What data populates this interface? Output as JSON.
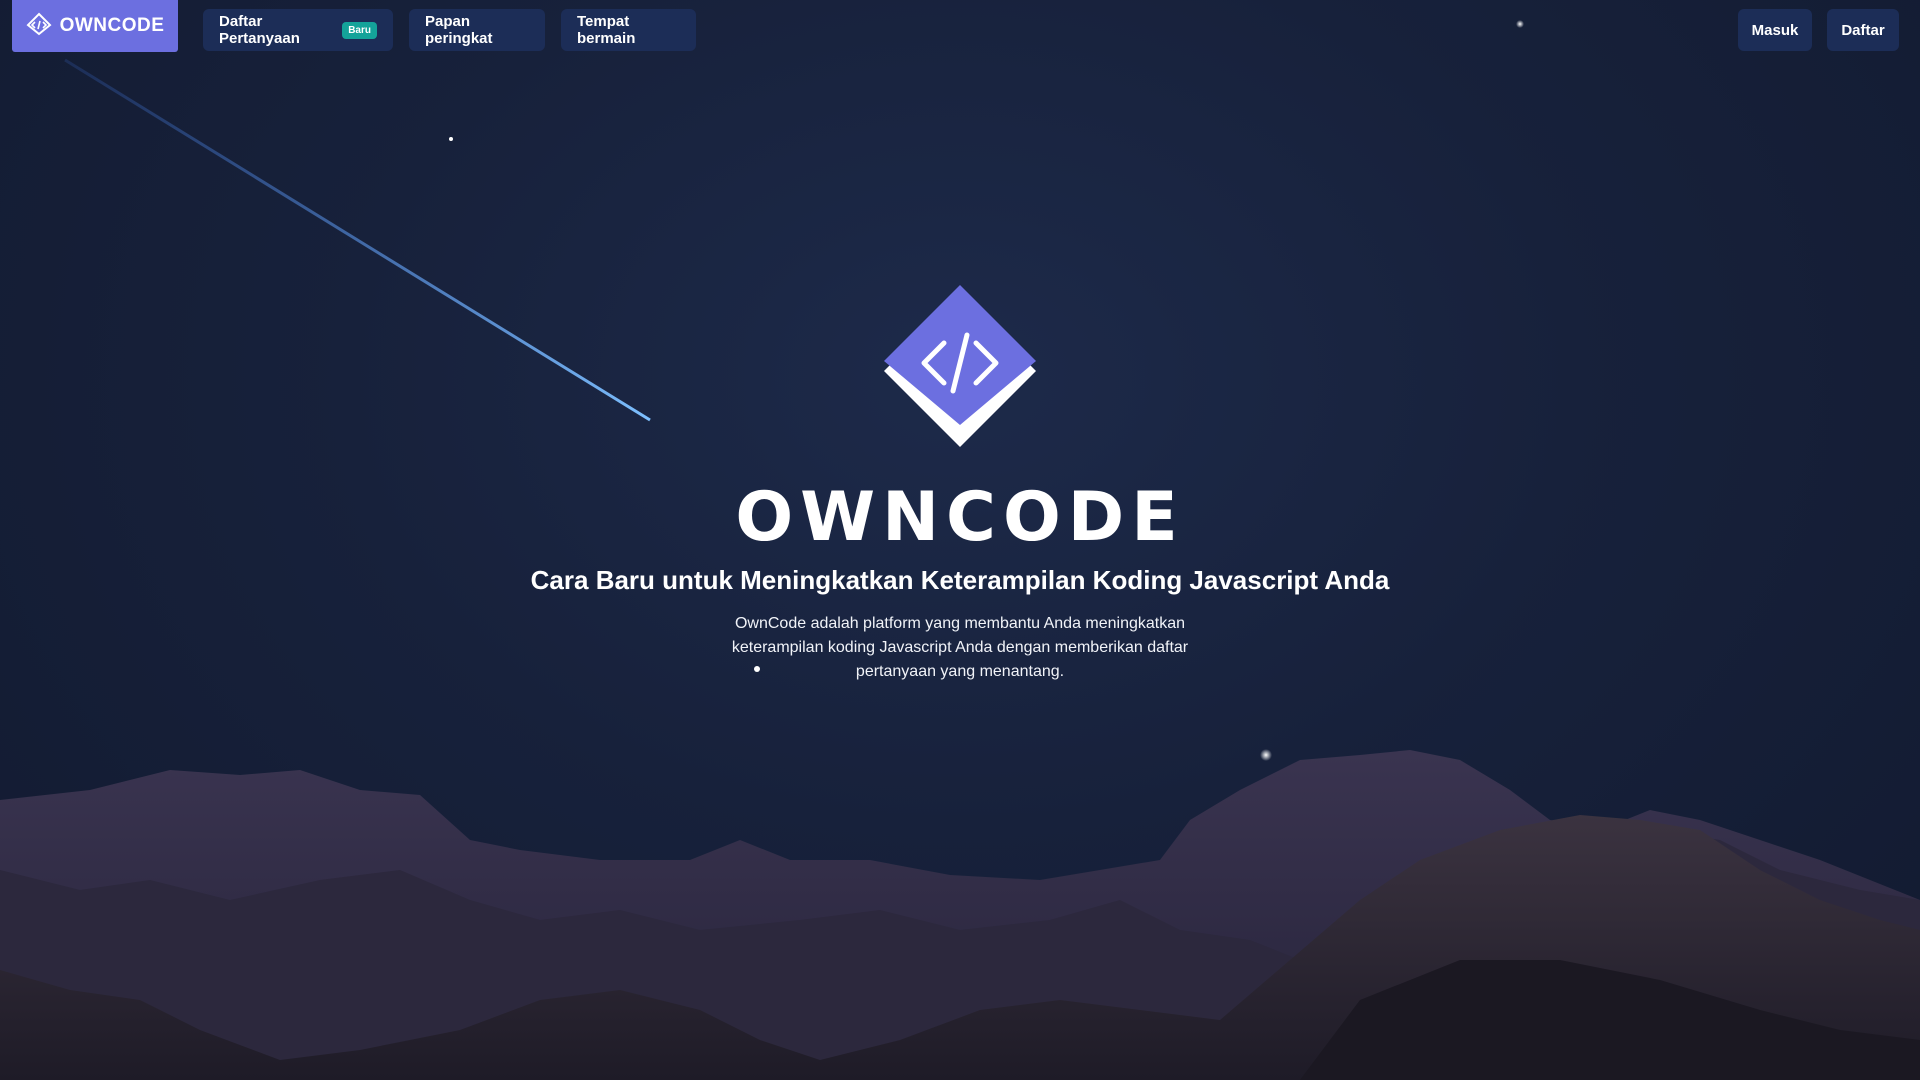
{
  "nav": {
    "logo_text": "OWNCODE",
    "items": [
      {
        "label": "Daftar Pertanyaan",
        "badge": "Baru"
      },
      {
        "label": "Papan peringkat"
      },
      {
        "label": "Tempat bermain"
      }
    ],
    "login_label": "Masuk",
    "register_label": "Daftar"
  },
  "hero": {
    "brand": "OWNCODE",
    "tagline": "Cara Baru untuk Meningkatkan Keterampilan Koding Javascript Anda",
    "description": "OwnCode adalah platform yang membantu Anda meningkatkan keterampilan koding Javascript Anda dengan memberikan daftar pertanyaan yang menantang."
  },
  "colors": {
    "accent": "#6c6fe0",
    "nav_button": "#1c2d57",
    "badge": "#14a39a",
    "sky": "#17213b"
  },
  "icons": {
    "logo": "code-diamond-icon"
  }
}
